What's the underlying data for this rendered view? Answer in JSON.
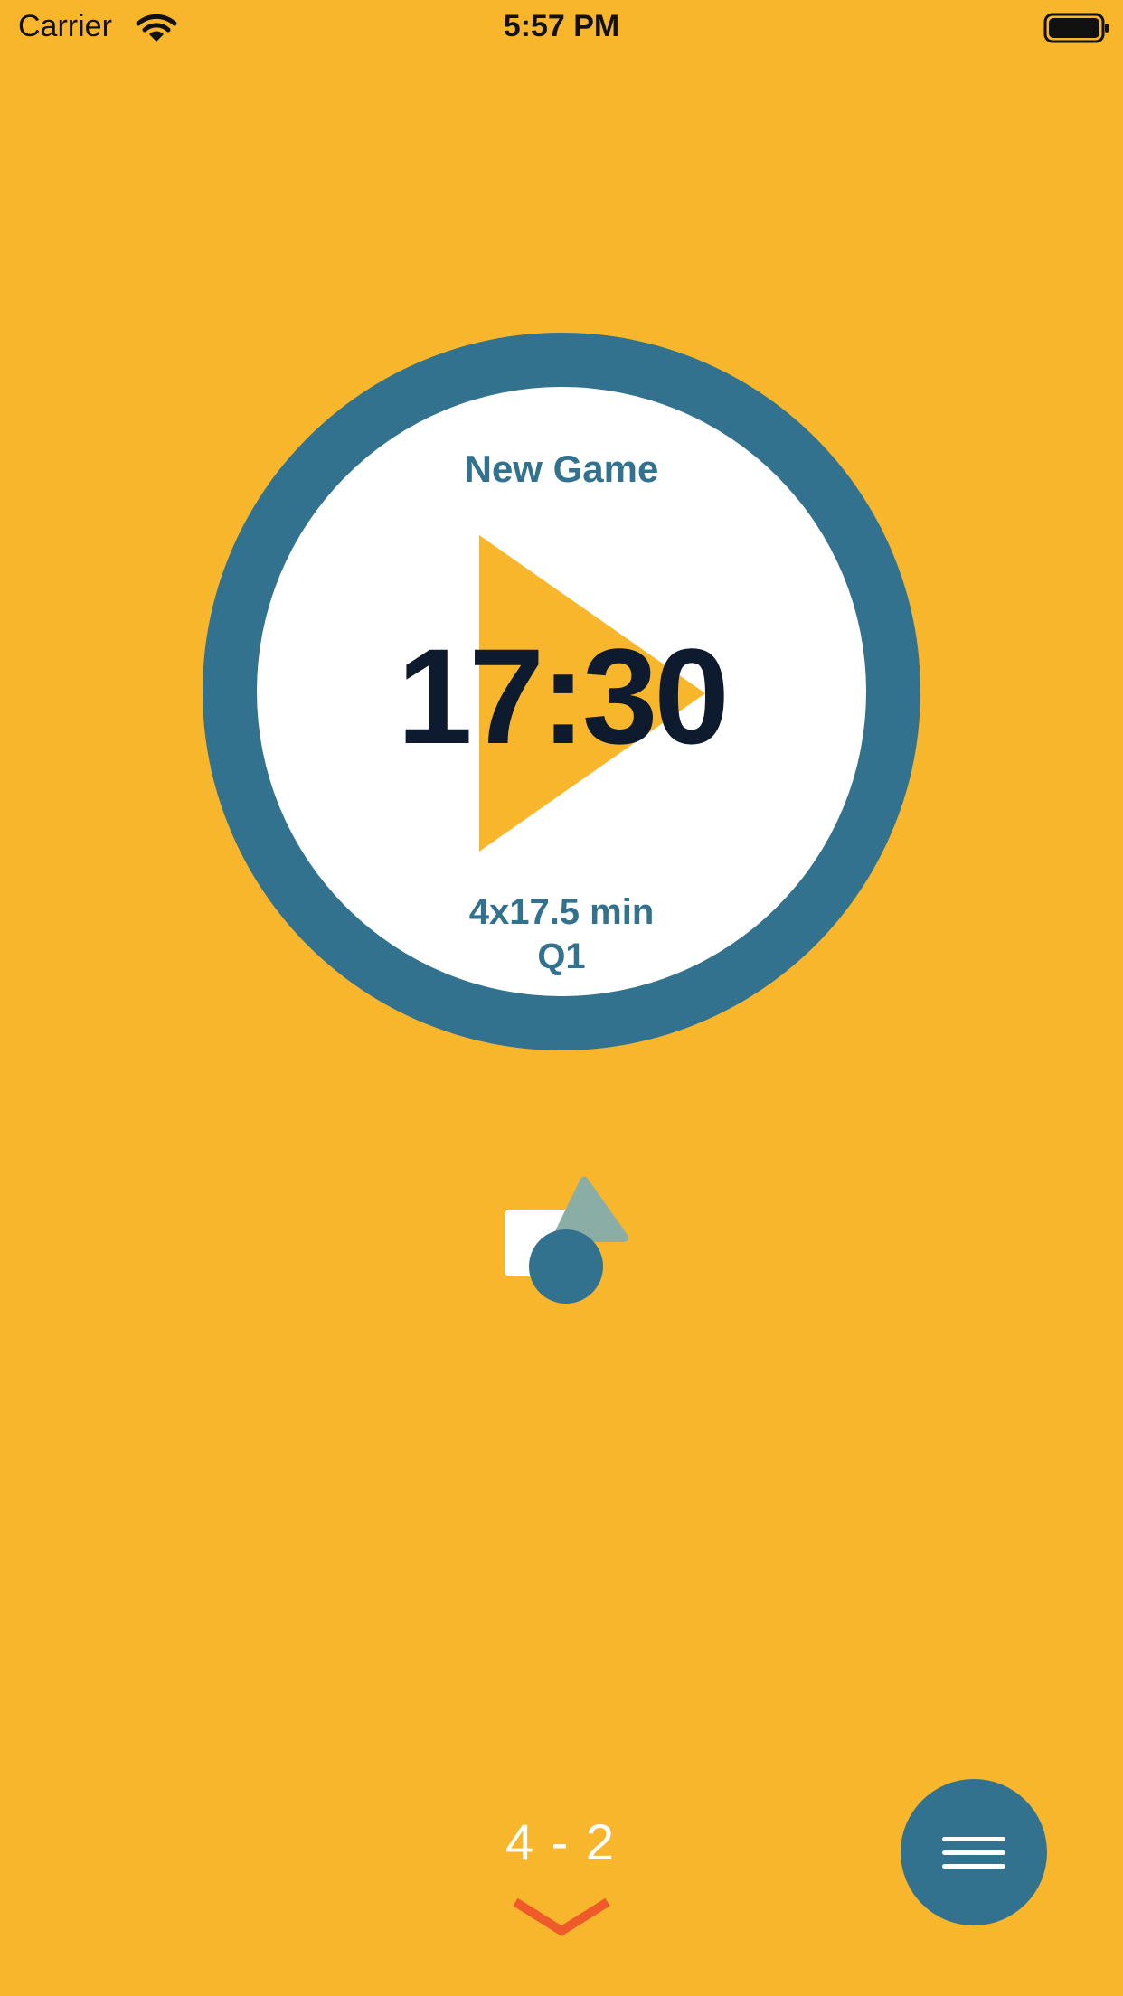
{
  "status_bar": {
    "carrier": "Carrier",
    "time": "5:57 PM"
  },
  "timer": {
    "title": "New Game",
    "clock": "17:30",
    "format": "4x17.5 min",
    "period": "Q1"
  },
  "score": "4 - 2",
  "icons": {
    "wifi": "wifi-icon",
    "battery": "battery-icon",
    "play": "play-icon",
    "shapes": "shapes-logo-icon",
    "chevron": "chevron-down-icon",
    "menu": "hamburger-menu-icon"
  },
  "colors": {
    "background": "#F8B62C",
    "ring": "#32728F",
    "clock_text": "#0E1A2E",
    "chevron": "#EE5A2A",
    "shape_triangle": "#8AADA6"
  }
}
